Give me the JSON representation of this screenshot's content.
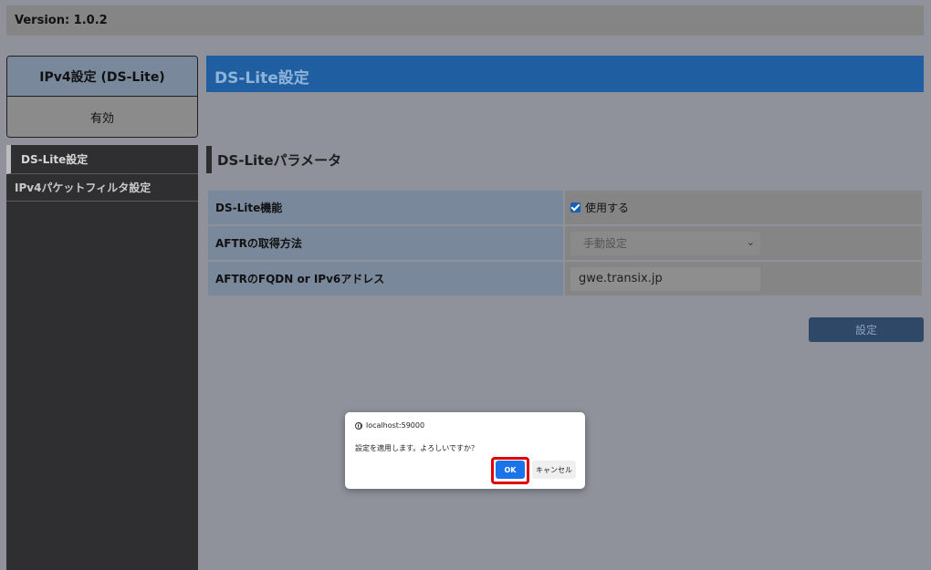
{
  "header": {
    "version": "Version: 1.0.2"
  },
  "mode_box": {
    "title": "IPv4設定 (DS-Lite)",
    "state": "有効"
  },
  "sidebar": {
    "items": [
      {
        "label": "DS-Lite設定",
        "active": true
      },
      {
        "label": "IPv4パケットフィルタ設定",
        "active": false
      }
    ]
  },
  "page": {
    "title": "DS-Lite設定",
    "section_title": "DS-Liteパラメータ"
  },
  "params": {
    "function": {
      "label": "DS-Lite機能",
      "checkbox_label": "使用する",
      "checked": true
    },
    "aftr_method": {
      "label": "AFTRの取得方法",
      "selected": "手動設定"
    },
    "aftr_address": {
      "label": "AFTRのFQDN or IPv6アドレス",
      "value": "gwe.transix.jp"
    }
  },
  "actions": {
    "set_label": "設定"
  },
  "dialog": {
    "origin": "localhost:59000",
    "message": "設定を適用します。よろしいですか？",
    "ok_label": "OK",
    "cancel_label": "キャンセル"
  },
  "colors": {
    "accent_blue": "#1f5ea0",
    "highlight": "#e00000",
    "ok_button": "#1a73e8"
  }
}
